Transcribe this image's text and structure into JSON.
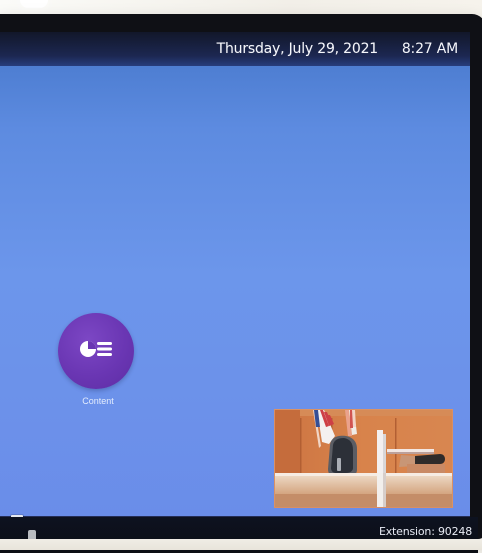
{
  "status_bar": {
    "date": "Thursday, July 29, 2021",
    "time": "8:27 AM"
  },
  "launcher": {
    "label": "Content",
    "icon": "content-share-icon"
  },
  "footer": {
    "extension": "Extension: 90248"
  },
  "preview": {
    "scene": "courtroom-camera-feed"
  },
  "colors": {
    "screen_gradient_top": "#4571c4",
    "screen_gradient_bottom": "#6a8de9",
    "launcher_purple": "#6a36b3",
    "status_bar": "#1c2751",
    "wood_panel": "#d37b49"
  }
}
